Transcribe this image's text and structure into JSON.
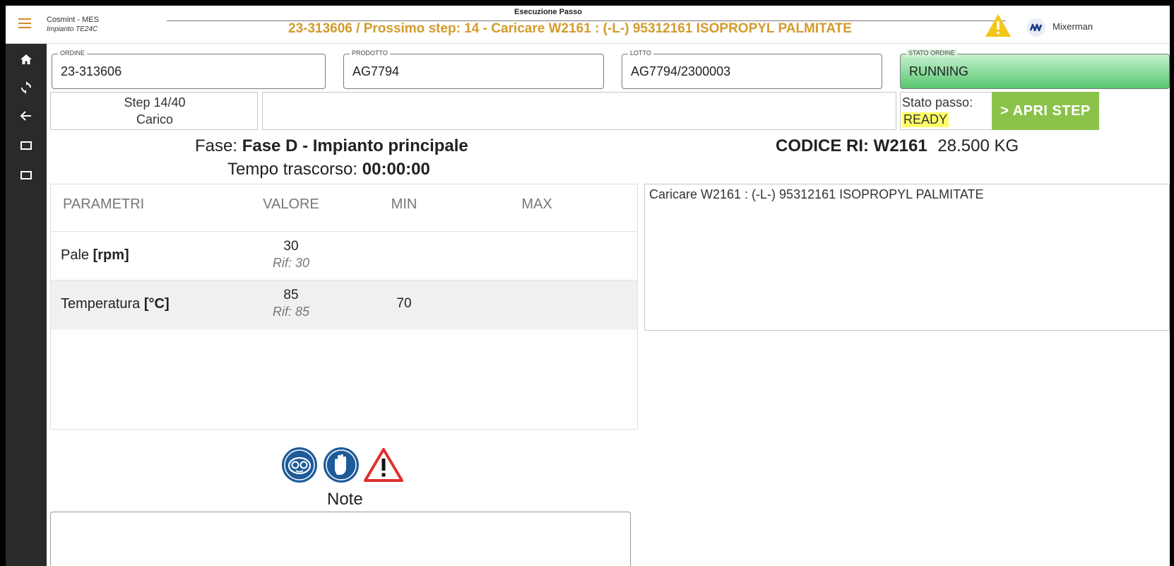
{
  "header": {
    "app_name": "Cosmint - MES",
    "plant": "Impianto TE24C",
    "page_title": "Esecuzione Passo",
    "step_headline": "23-313606 / Prossimo step: 14 - Caricare W2161 : (-L-) 95312161 ISOPROPYL PALMITATE",
    "user": "Mixerman"
  },
  "order": {
    "ordine_label": "ORDINE",
    "ordine_value": "23-313606",
    "prodotto_label": "PRODOTTO",
    "prodotto_value": "AG7794",
    "lotto_label": "LOTTO",
    "lotto_value": "AG7794/2300003",
    "stato_label": "STATO ORDINE",
    "stato_value": "RUNNING"
  },
  "step": {
    "step_count": "Step 14/40",
    "step_type": "Carico",
    "stato_passo_label": "Stato passo:",
    "stato_passo_value": "READY",
    "apri_label": "> APRI STEP"
  },
  "phase": {
    "fase_label": "Fase:",
    "fase_value": "Fase D - Impianto principale",
    "tempo_label": "Tempo trascorso:",
    "tempo_value": "00:00:00",
    "codice_label": "CODICE RI: W2161",
    "quantity": "28.500 KG"
  },
  "params": {
    "headers": [
      "PARAMETRI",
      "VALORE",
      "MIN",
      "MAX"
    ],
    "rows": [
      {
        "name": "Pale",
        "unit": "[rpm]",
        "value": "30",
        "ref": "Rif: 30",
        "min": "",
        "max": ""
      },
      {
        "name": "Temperatura",
        "unit": "[°C]",
        "value": "85",
        "ref": "Rif: 85",
        "min": "70",
        "max": ""
      }
    ]
  },
  "description": "Caricare W2161 : (-L-) 95312161 ISOPROPYL PALMITATE",
  "ppe_icons": [
    "goggles-icon",
    "gloves-icon",
    "hazard-warning-icon"
  ],
  "note_label": "Note",
  "colors": {
    "accent_orange": "#d39b2c",
    "running_green": "#56c66f",
    "apri_green": "#8bc34a",
    "ready_highlight": "#ffff66",
    "ppe_blue": "#1e5b9a",
    "sidebar": "#2a2a2a"
  }
}
